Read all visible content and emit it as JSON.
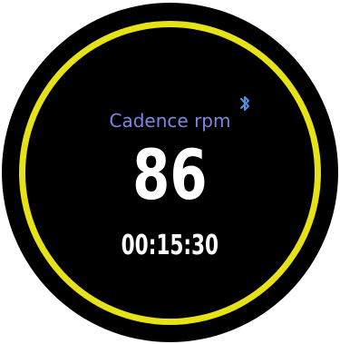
{
  "screen": {
    "metric_label": "Cadence rpm",
    "metric_value": "86",
    "elapsed_time": "00:15:30"
  },
  "status": {
    "bluetooth_icon": "bluetooth-icon"
  },
  "colors": {
    "ring": "#e6e215",
    "label": "#7d86e0",
    "bluetooth": "#4f8fe6",
    "value": "#ffffff",
    "background": "#000000"
  }
}
